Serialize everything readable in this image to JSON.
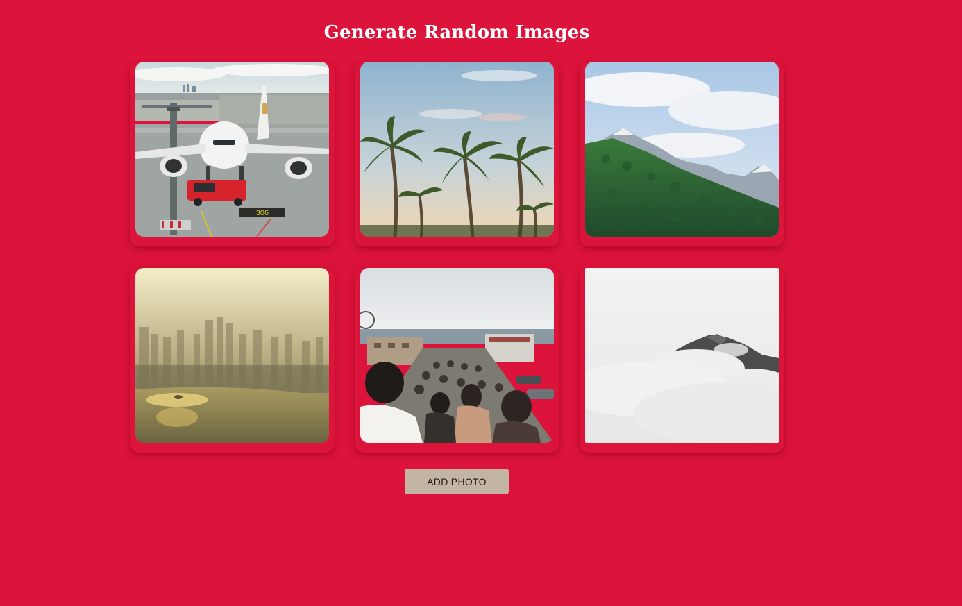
{
  "header": {
    "title": "Generate Random Images"
  },
  "gallery": {
    "photos": [
      {
        "subject": "airplane-on-tarmac"
      },
      {
        "subject": "palm-trees-sky"
      },
      {
        "subject": "forested-mountain"
      },
      {
        "subject": "hazy-city-skyline"
      },
      {
        "subject": "crowded-pier"
      },
      {
        "subject": "mountain-in-clouds"
      }
    ]
  },
  "actions": {
    "add_photo_label": "ADD PHOTO"
  },
  "colors": {
    "background": "#dc133a",
    "button": "#c4b4a4",
    "title": "#ffffff"
  }
}
